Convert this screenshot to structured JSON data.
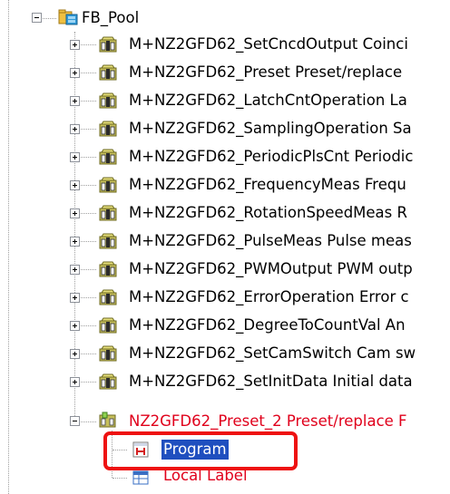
{
  "tree": {
    "root": {
      "label": "FB_Pool",
      "icon": "folder-pool-icon",
      "expanded": true
    },
    "items": [
      {
        "label": "M+NZ2GFD62_SetCncdOutput Coinci",
        "icon": "fb-library-icon"
      },
      {
        "label": "M+NZ2GFD62_Preset Preset/replace",
        "icon": "fb-library-icon"
      },
      {
        "label": "M+NZ2GFD62_LatchCntOperation La",
        "icon": "fb-library-icon"
      },
      {
        "label": "M+NZ2GFD62_SamplingOperation Sa",
        "icon": "fb-library-icon"
      },
      {
        "label": "M+NZ2GFD62_PeriodicPlsCnt Periodic",
        "icon": "fb-library-icon"
      },
      {
        "label": "M+NZ2GFD62_FrequencyMeas Frequ",
        "icon": "fb-library-icon"
      },
      {
        "label": "M+NZ2GFD62_RotationSpeedMeas R",
        "icon": "fb-library-icon"
      },
      {
        "label": "M+NZ2GFD62_PulseMeas Pulse meas",
        "icon": "fb-library-icon"
      },
      {
        "label": "M+NZ2GFD62_PWMOutput PWM outp",
        "icon": "fb-library-icon"
      },
      {
        "label": "M+NZ2GFD62_ErrorOperation Error c",
        "icon": "fb-library-icon"
      },
      {
        "label": "M+NZ2GFD62_DegreeToCountVal An",
        "icon": "fb-library-icon"
      },
      {
        "label": "M+NZ2GFD62_SetCamSwitch Cam sw",
        "icon": "fb-library-icon"
      },
      {
        "label": "M+NZ2GFD62_SetInitData Initial data",
        "icon": "fb-library-icon"
      }
    ],
    "user_fb": {
      "label": "NZ2GFD62_Preset_2 Preset/replace F",
      "icon": "fb-user-icon",
      "color": "#e0001b",
      "expanded": true,
      "children": [
        {
          "label": "Program",
          "icon": "program-icon",
          "selected": true
        },
        {
          "label": "Local Label",
          "icon": "local-label-icon",
          "color": "#e0001b"
        }
      ]
    }
  },
  "colors": {
    "selection": "#1f4fbf",
    "highlight_box": "#ee1111"
  }
}
